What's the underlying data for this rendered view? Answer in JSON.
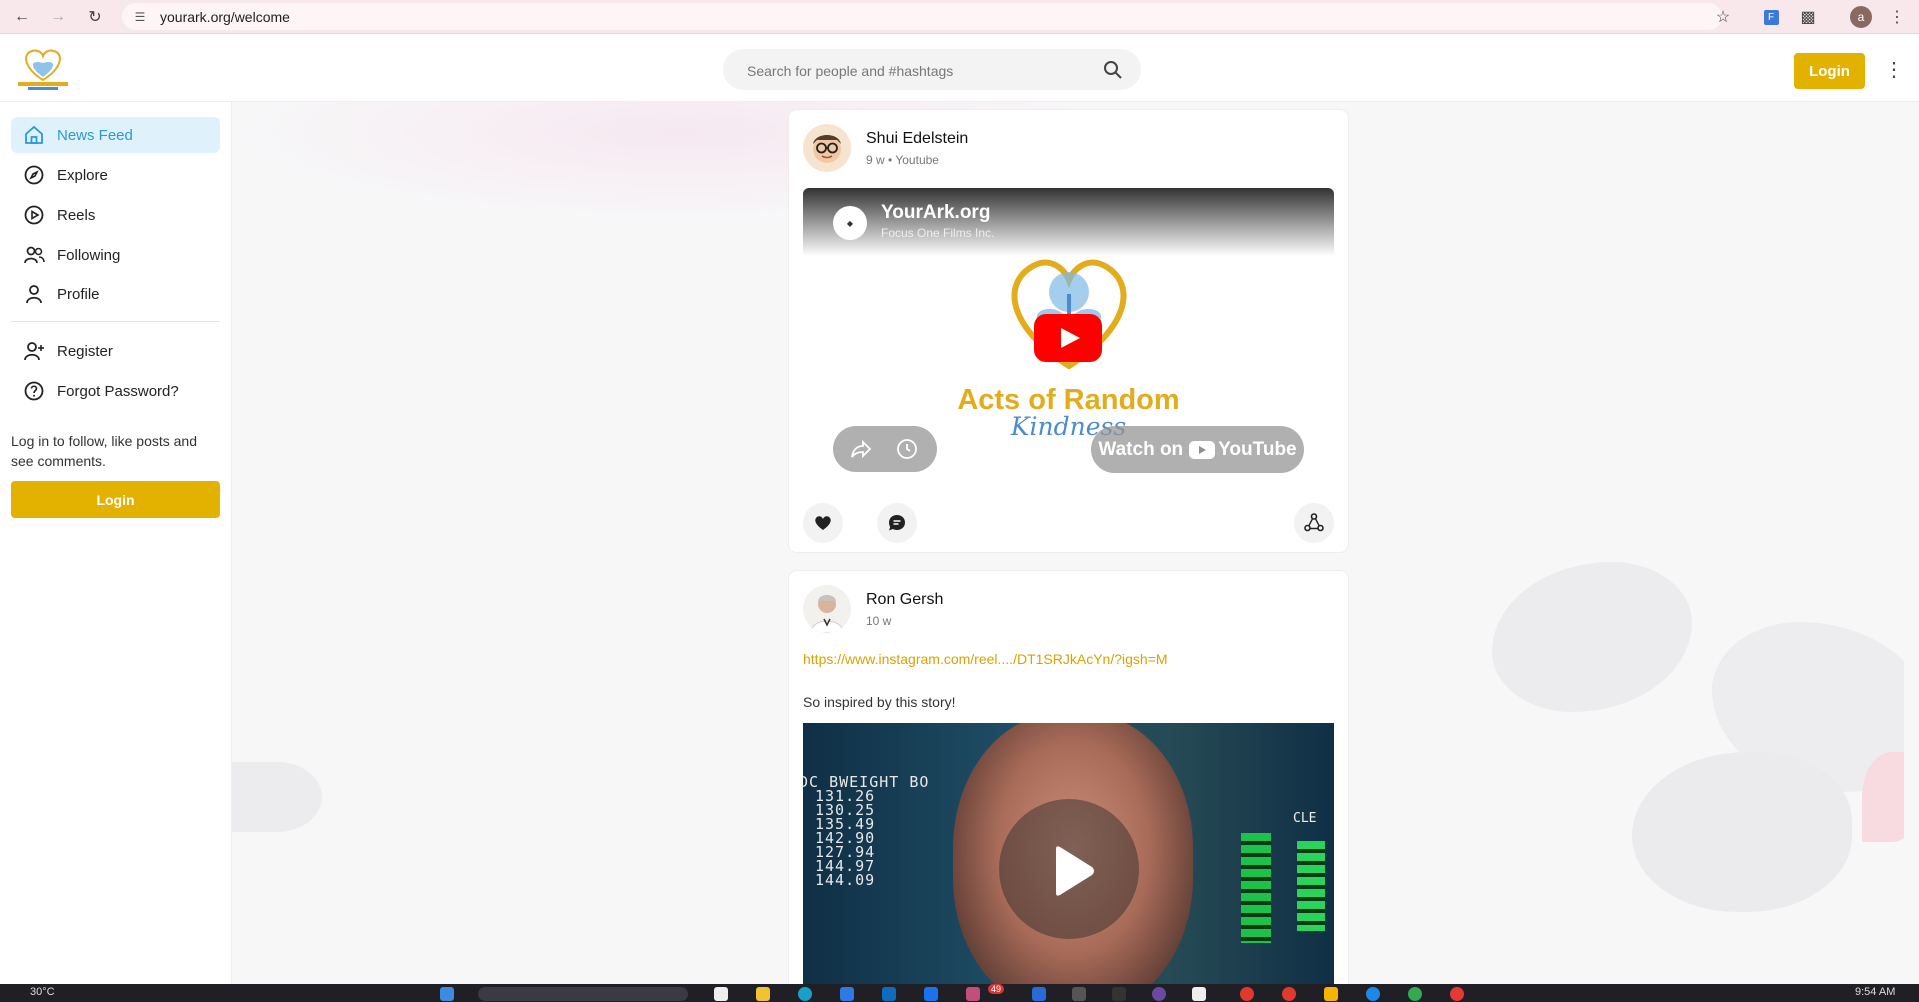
{
  "browser": {
    "url": "yourark.org/welcome",
    "profile_initial": "a"
  },
  "header": {
    "search_placeholder": "Search for people and #hashtags",
    "login_label": "Login"
  },
  "sidebar": {
    "items": [
      {
        "label": "News Feed",
        "icon": "home-icon",
        "active": true
      },
      {
        "label": "Explore",
        "icon": "compass-icon"
      },
      {
        "label": "Reels",
        "icon": "play-circle-icon"
      },
      {
        "label": "Following",
        "icon": "users-icon"
      },
      {
        "label": "Profile",
        "icon": "user-icon"
      }
    ],
    "secondary": [
      {
        "label": "Register",
        "icon": "user-plus-icon"
      },
      {
        "label": "Forgot Password?",
        "icon": "help-circle-icon"
      }
    ],
    "note": "Log in to follow, like posts and see comments.",
    "login_label": "Login"
  },
  "posts": [
    {
      "author": "Shui Edelstein",
      "age": "9 w",
      "source": "Youtube",
      "video": {
        "channel_title": "YourArk.org",
        "channel_sub": "Focus One Films Inc.",
        "brand_text": "Acts of Random",
        "brand_script": "Kindness",
        "watch_label": "Watch on",
        "yt_word": "YouTube"
      }
    },
    {
      "author": "Ron Gersh",
      "age": "10 w",
      "link": "https://www.instagram.com/reel..../DT1SRJkAcYn/?igsh=M",
      "text": "So inspired by this story!",
      "scoreboard": {
        "head1": "DC BWEIGHT",
        "head2": "BO",
        "head3": "CLE",
        "rows": [
          "131.26",
          "130.25",
          "135.49",
          "142.90",
          "127.94",
          "144.97",
          "144.09"
        ]
      }
    }
  ],
  "taskbar": {
    "weather": "30°C",
    "time": "9:54 AM",
    "badge": "49"
  },
  "colors": {
    "accent": "#e3b100",
    "active_bg": "#dff1fb",
    "active_text": "#2a9ad6",
    "link": "#d8a300"
  }
}
